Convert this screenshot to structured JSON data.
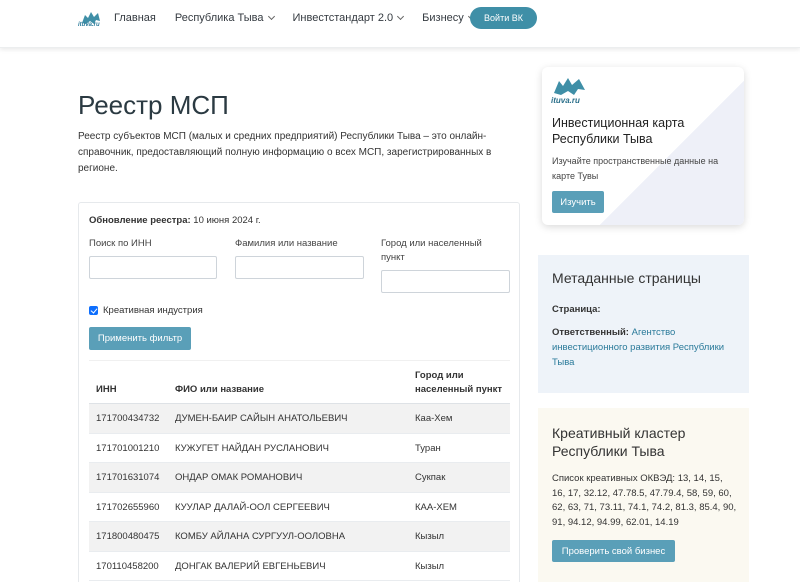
{
  "header": {
    "logo_text": "ituva.ru",
    "nav": [
      {
        "label": "Главная",
        "has_dropdown": false
      },
      {
        "label": "Республика Тыва",
        "has_dropdown": true
      },
      {
        "label": "Инвестстандарт 2.0",
        "has_dropdown": true
      },
      {
        "label": "Бизнесу",
        "has_dropdown": true
      }
    ],
    "vk_button": "Войти ВК"
  },
  "main": {
    "title": "Реестр МСП",
    "description": "Реестр субъектов МСП (малых и средних предприятий) Республики Тыва – это онлайн-справочник, предоставляющий полную информацию о всех МСП, зарегистрированных в регионе.",
    "filter": {
      "update_label": "Обновление реестра:",
      "update_date": "10 июня 2024 г.",
      "inn_label": "Поиск по ИНН",
      "inn_value": "",
      "name_label": "Фамилия или название",
      "name_value": "",
      "city_label": "Город или населенный пункт",
      "city_value": "",
      "checkbox_label": "Креативная индустрия",
      "checkbox_checked": true,
      "apply_button": "Применить фильтр"
    },
    "table": {
      "headers": [
        "ИНН",
        "ФИО или название",
        "Город или населенный пункт"
      ],
      "rows": [
        {
          "inn": "171700434732",
          "name": "ДУМЕН-БАИР САЙЫН АНАТОЛЬЕВИЧ",
          "city": "Каа-Хем"
        },
        {
          "inn": "171701001210",
          "name": "КУЖУГЕТ НАЙДАН РУСЛАНОВИЧ",
          "city": "Туран"
        },
        {
          "inn": "171701631074",
          "name": "ОНДАР ОМАК РОМАНОВИЧ",
          "city": "Сукпак"
        },
        {
          "inn": "171702655960",
          "name": "КУУЛАР ДАЛАЙ-ООЛ СЕРГЕЕВИЧ",
          "city": "КАА-ХЕМ"
        },
        {
          "inn": "171800480475",
          "name": "КОМБУ АЙЛАНА СУРГУУЛ-ООЛОВНА",
          "city": "Кызыл"
        },
        {
          "inn": "170110458200",
          "name": "ДОНГАК ВАЛЕРИЙ ЕВГЕНЬЕВИЧ",
          "city": "Кызыл"
        }
      ]
    }
  },
  "sidebar": {
    "map_card": {
      "logo_text": "ituva.ru",
      "title": "Инвестиционная карта Республики Тыва",
      "description": "Изучайте пространственные данные на карте Тувы",
      "button": "Изучить"
    },
    "meta_card": {
      "title": "Метаданные страницы",
      "page_label": "Страница:",
      "responsible_label": "Ответственный:",
      "responsible_value": "Агентство инвестиционного развития Республики Тыва"
    },
    "cluster_card": {
      "title": "Креативный кластер Республики Тыва",
      "description": "Список креативных ОКВЭД: 13, 14, 15, 16, 17, 32.12, 47.78.5, 47.79.4, 58, 59, 60, 62, 63, 71, 73.11, 74.1, 74.2, 81.3, 85.4, 90, 91, 94.12, 94.99, 62.01, 14.19",
      "button": "Проверить свой бизнес"
    }
  },
  "colors": {
    "accent": "#5a9fb8",
    "vk_button": "#3f8fa7",
    "link": "#2a7a9a",
    "meta_bg": "#eef3f9",
    "cluster_bg": "#fbf9f1"
  }
}
